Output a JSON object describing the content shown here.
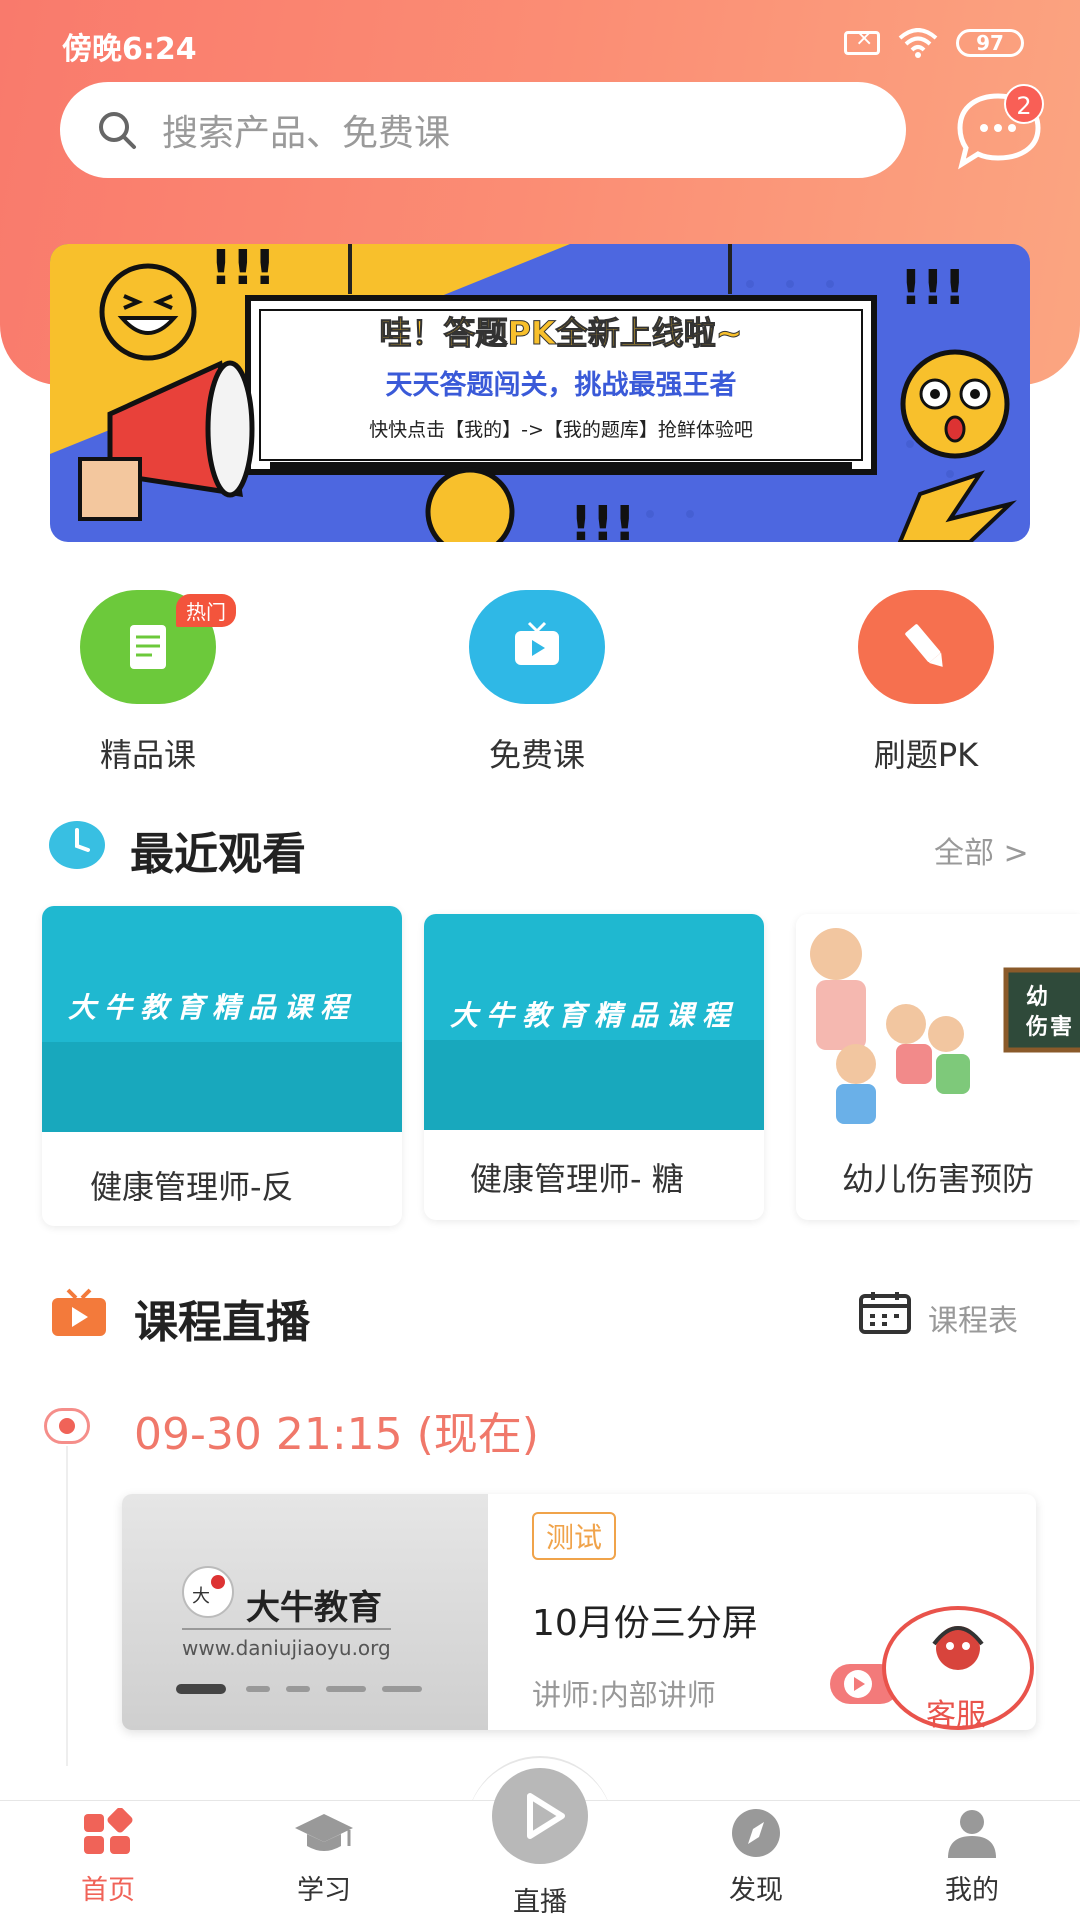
{
  "status_bar": {
    "time": "傍晚6:24",
    "battery": "97"
  },
  "search": {
    "placeholder": "搜索产品、免费课"
  },
  "messages": {
    "badge": "2"
  },
  "banner": {
    "title": "哇！答题PK全新上线啦~",
    "subtitle": "天天答题闯关，挑战最强王者",
    "note": "快快点击【我的】->【我的题库】抢鲜体验吧"
  },
  "quick_entries": [
    {
      "label": "精品课",
      "badge": "热门",
      "color": "#6cc93b",
      "icon": "document-icon"
    },
    {
      "label": "免费课",
      "color": "#2fb8e6",
      "icon": "tv-play-icon"
    },
    {
      "label": "刷题PK",
      "color": "#f6704f",
      "icon": "pencil-icon"
    }
  ],
  "recent": {
    "title": "最近观看",
    "more": "全部 >",
    "cards": [
      {
        "thumb_text": "大牛教育精品课程",
        "title": "健康管理师-反"
      },
      {
        "thumb_text": "大牛教育精品课程",
        "title": "健康管理师- 糖"
      },
      {
        "thumb_text": "幼 伤害",
        "title": "幼儿伤害预防"
      }
    ]
  },
  "live": {
    "title": "课程直播",
    "schedule": "课程表",
    "time": "09-30   21:15 (现在)",
    "card": {
      "thumb_brand": "大牛教育",
      "thumb_url": "www.daniujiaoyu.org",
      "tag": "测试",
      "course_title": "10月份三分屏",
      "teacher": "讲师:内部讲师"
    }
  },
  "service": {
    "label": "客服"
  },
  "bottom_nav": [
    {
      "label": "首页",
      "active": true
    },
    {
      "label": "学习"
    },
    {
      "label": "直播"
    },
    {
      "label": "发现"
    },
    {
      "label": "我的"
    }
  ],
  "colors": {
    "accent": "#f06358",
    "header_start": "#f97a6c",
    "header_end": "#fba581"
  }
}
